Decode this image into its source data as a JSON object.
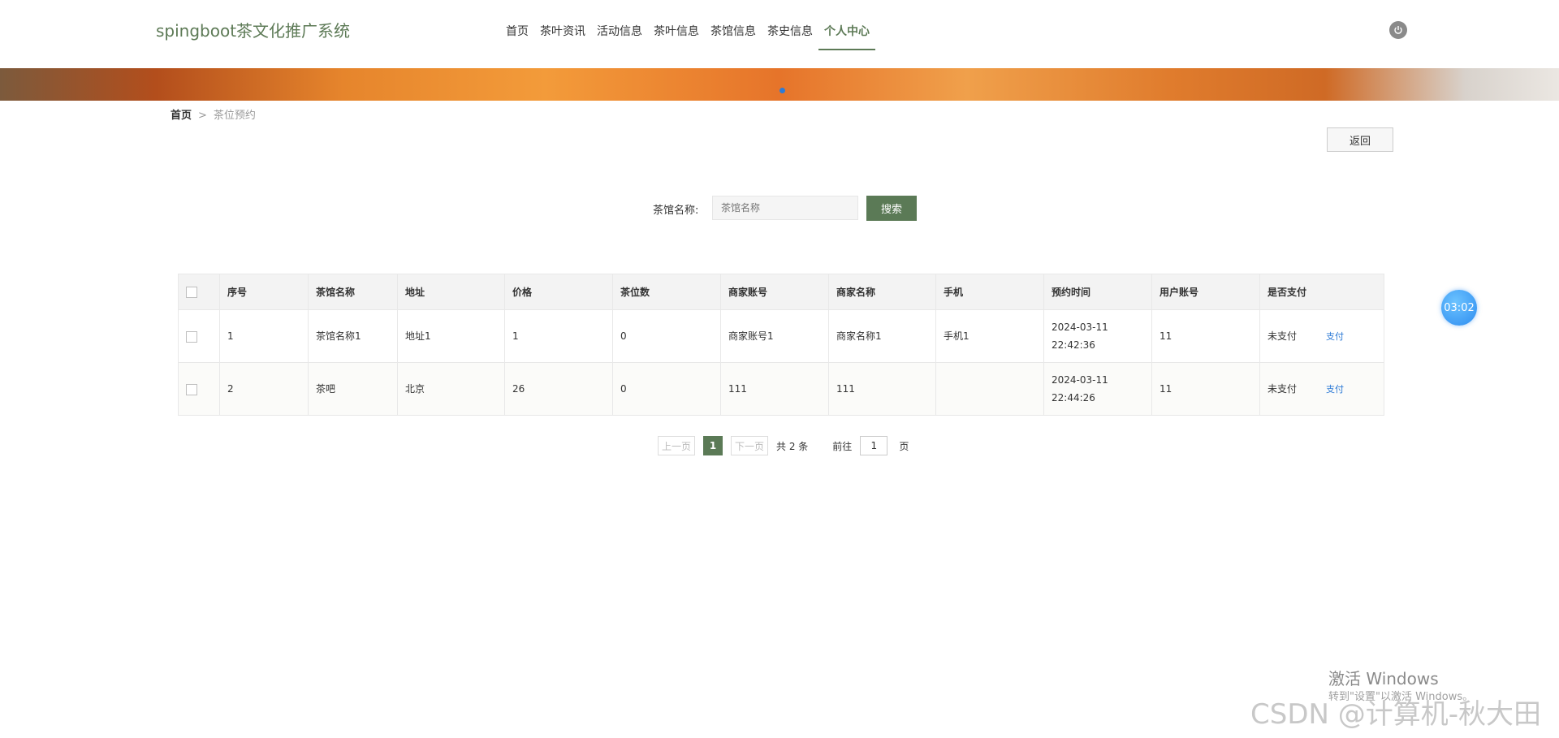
{
  "header": {
    "brand": "spingboot茶文化推广系统",
    "nav": [
      {
        "label": "首页",
        "active": false
      },
      {
        "label": "茶叶资讯",
        "active": false
      },
      {
        "label": "活动信息",
        "active": false
      },
      {
        "label": "茶叶信息",
        "active": false
      },
      {
        "label": "茶馆信息",
        "active": false
      },
      {
        "label": "茶史信息",
        "active": false
      },
      {
        "label": "个人中心",
        "active": true
      }
    ],
    "power_icon": "power-icon"
  },
  "breadcrumb": {
    "home": "首页",
    "separator": ">",
    "current": "茶位预约"
  },
  "back_label": "返回",
  "search": {
    "label": "茶馆名称:",
    "placeholder": "茶馆名称",
    "button": "搜索"
  },
  "table": {
    "columns": [
      "序号",
      "茶馆名称",
      "地址",
      "价格",
      "茶位数",
      "商家账号",
      "商家名称",
      "手机",
      "预约时间",
      "用户账号",
      "是否支付"
    ],
    "rows": [
      {
        "cells": [
          "1",
          "茶馆名称1",
          "地址1",
          "1",
          "0",
          "商家账号1",
          "商家名称1",
          "手机1",
          "2024-03-11 22:42:36",
          "11",
          "未支付"
        ],
        "action": "支付"
      },
      {
        "cells": [
          "2",
          "茶吧",
          "北京",
          "26",
          "0",
          "111",
          "111",
          "",
          "2024-03-11 22:44:26",
          "11",
          "未支付"
        ],
        "action": "支付"
      }
    ]
  },
  "pagination": {
    "prev": "上一页",
    "current": "1",
    "next": "下一页",
    "total": "共 2 条",
    "goto": "前往",
    "goto_value": "1",
    "page_unit": "页"
  },
  "timer": "03:02",
  "watermarks": {
    "windows_title": "激活 Windows",
    "windows_sub": "转到\"设置\"以激活 Windows。",
    "csdn": "CSDN @计算机-秋大田"
  },
  "colors": {
    "accent": "#5b7a56",
    "link": "#2e7bd6"
  }
}
